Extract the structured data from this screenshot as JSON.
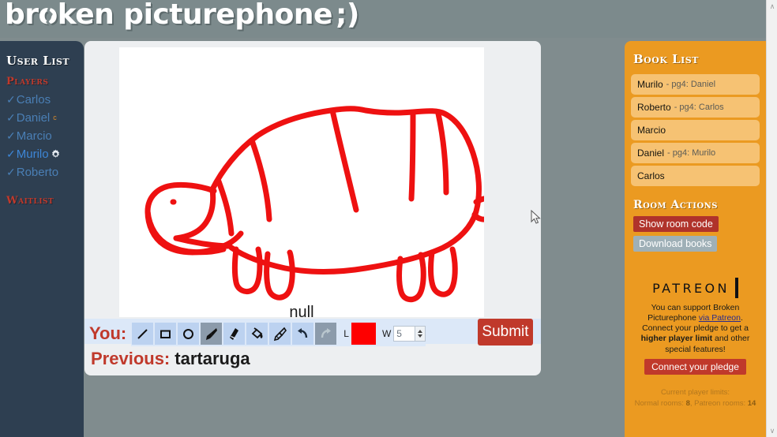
{
  "header": {
    "title": "broken picturephone",
    "smiley": ";)"
  },
  "user_list": {
    "title": "User List",
    "players_heading": "Players",
    "waitlist_heading": "Waitlist",
    "players": [
      {
        "name": "Carlos",
        "tick": "✓",
        "marker": "",
        "is_you": false,
        "gear": false
      },
      {
        "name": "Daniel",
        "tick": "✓",
        "marker": "c",
        "is_you": false,
        "gear": false
      },
      {
        "name": "Marcio",
        "tick": "✓",
        "marker": "",
        "is_you": false,
        "gear": false
      },
      {
        "name": "Murilo",
        "tick": "✓",
        "marker": "",
        "is_you": true,
        "gear": true
      },
      {
        "name": "Roberto",
        "tick": "✓",
        "marker": "",
        "is_you": false,
        "gear": false
      }
    ],
    "waitlist": []
  },
  "game": {
    "canvas_caption": "null",
    "you_label": "You:",
    "previous_label": "Previous:",
    "previous_word": "tartaruga",
    "submit_label": "Submit",
    "tools": [
      {
        "id": "line-tool",
        "name": "line",
        "selected": false,
        "disabled": false
      },
      {
        "id": "rectangle-tool",
        "name": "rectangle",
        "selected": false,
        "disabled": false
      },
      {
        "id": "ellipse-tool",
        "name": "ellipse",
        "selected": false,
        "disabled": false
      },
      {
        "id": "brush-tool",
        "name": "brush",
        "selected": true,
        "disabled": false
      },
      {
        "id": "eraser-tool",
        "name": "eraser",
        "selected": false,
        "disabled": false
      },
      {
        "id": "fill-tool",
        "name": "fill-bucket",
        "selected": false,
        "disabled": false
      },
      {
        "id": "spray-tool",
        "name": "spray",
        "selected": false,
        "disabled": false
      },
      {
        "id": "undo-button",
        "name": "undo",
        "selected": false,
        "disabled": false
      },
      {
        "id": "redo-button",
        "name": "redo",
        "selected": false,
        "disabled": true
      }
    ],
    "line_color_label": "L",
    "line_color": "#fe0000",
    "width_label": "W",
    "width_value": "5"
  },
  "book_list": {
    "title": "Book List",
    "items": [
      {
        "owner": "Murilo",
        "sub": "- pg4: Daniel"
      },
      {
        "owner": "Roberto",
        "sub": "- pg4: Carlos"
      },
      {
        "owner": "Marcio",
        "sub": ""
      },
      {
        "owner": "Daniel",
        "sub": "- pg4: Murilo"
      },
      {
        "owner": "Carlos",
        "sub": ""
      }
    ]
  },
  "room_actions": {
    "title": "Room Actions",
    "show_room_code_label": "Show room code",
    "download_books_label": "Download books"
  },
  "patreon": {
    "logo_text": "PATREON",
    "body_prefix": "You can support Broken Picturephone ",
    "link1": "via Patreon",
    "body_mid": ". Connect your pledge to get a ",
    "bold": "higher player limit",
    "body_suffix": " and other special features!",
    "connect_label": "Connect your pledge",
    "limits_title": "Current player limits:",
    "limits_normal_label": "Normal rooms: ",
    "limits_normal_value": "8",
    "limits_patreon_label": ", Patreon rooms: ",
    "limits_patreon_value": "14"
  },
  "scrollbar": {
    "up_arrow": "∧",
    "down_arrow": "∨"
  },
  "colors": {
    "page_bg": "#808c8e",
    "sidebar_bg": "#2e3f51",
    "accent_orange": "#eb9a21",
    "accent_red": "#c0392b",
    "toolbar_blue": "#dce8f8"
  }
}
